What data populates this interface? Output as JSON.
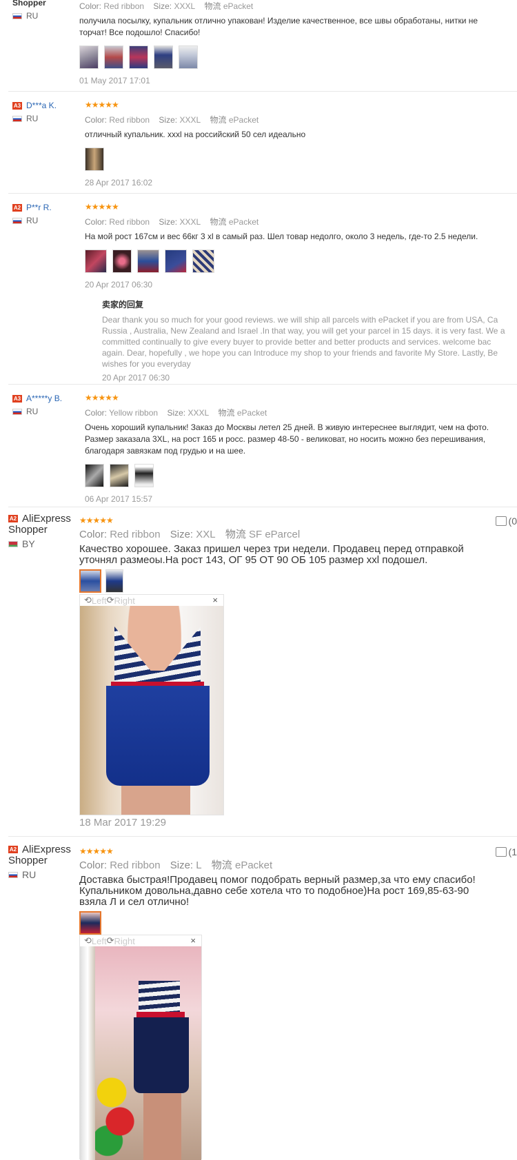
{
  "colors": {
    "accent": "#f79411",
    "link": "#2a66b4",
    "badge": "#e0401f"
  },
  "reviews": [
    {
      "name": "Shopper",
      "badge": "",
      "country": "RU",
      "stars": "★★★★★",
      "color_label": "Color:",
      "color_value": "Red ribbon",
      "size_label": "Size:",
      "size_value": "XXXL",
      "shipping_label": "物流",
      "shipping_value": "ePacket",
      "text": "получила посылку, купальник отлично упакован! Изделие качественное, все швы обработаны, нитки не торчат! Все подошло! Спасибо!",
      "date": "01 May 2017 17:01"
    },
    {
      "name": "D***a K.",
      "badge": "A3",
      "country": "RU",
      "stars": "★★★★★",
      "color_label": "Color:",
      "color_value": "Red ribbon",
      "size_label": "Size:",
      "size_value": "XXXL",
      "shipping_label": "物流",
      "shipping_value": "ePacket",
      "text": "отличный купальник. xxxl на российский 50 сел идеально",
      "date": "28 Apr 2017 16:02"
    },
    {
      "name": "P**r R.",
      "badge": "A2",
      "country": "RU",
      "stars": "★★★★★",
      "color_label": "Color:",
      "color_value": "Red ribbon",
      "size_label": "Size:",
      "size_value": "XXXL",
      "shipping_label": "物流",
      "shipping_value": "ePacket",
      "text": "На мой рост 167см и вес 66кг 3 xl в самый раз. Шел товар недолго, около 3 недель, где-то 2.5 недели.",
      "date": "20 Apr 2017 06:30",
      "reply_title": "卖家的回复",
      "reply_lines": [
        "Dear thank you so much for your good reviews. we will ship all parcels with ePacket if you are from USA, Ca",
        "Russia , Australia, New Zealand and Israel .In that way, you will get your parcel in 15 days. it is very fast. We a",
        "committed continually to give every buyer to provide better and better products and services. welcome bac",
        "again. Dear, hopefully , we hope you can Introduce my shop to your friends and favorite My Store. Lastly, Be",
        "wishes for you everyday"
      ],
      "reply_date": "20 Apr 2017 06:30"
    },
    {
      "name": "A*****y B.",
      "badge": "A3",
      "country": "RU",
      "stars": "★★★★★",
      "color_label": "Color:",
      "color_value": "Yellow ribbon",
      "size_label": "Size:",
      "size_value": "XXXL",
      "shipping_label": "物流",
      "shipping_value": "ePacket",
      "text_lines": [
        "Очень хороший купальник! Заказ до Москвы летел 25 дней. В живую интереснее выглядит, чем на фото.",
        "Размер заказала 3XL, на рост 165 и росс. размер 48-50 - великоват, но носить можно без перешивания,",
        "благодаря завязкам под грудью и на шее."
      ],
      "date": "06 Apr 2017 15:57"
    },
    {
      "name": "AliExpress",
      "name2": "Shopper",
      "badge": "A2",
      "country": "BY",
      "stars": "★★★★★",
      "color_label": "Color:",
      "color_value": "Red ribbon",
      "size_label": "Size:",
      "size_value": "XXL",
      "shipping_label": "物流",
      "shipping_value": "SF eParcel",
      "text_lines": [
        "Качество хорошее. Заказ пришел через три недели. Продавец перед отправкой",
        "уточнял размеоы.На рост 143, ОГ 95 ОТ 90 ОБ 105 размер xxl подошел."
      ],
      "viewer_left": "Left",
      "viewer_right": "Right",
      "viewer_close": "×",
      "helpful": "(0",
      "date": "18 Mar 2017 19:29"
    },
    {
      "name": "AliExpress",
      "name2": "Shopper",
      "badge": "A2",
      "country": "RU",
      "stars": "★★★★★",
      "color_label": "Color:",
      "color_value": "Red ribbon",
      "size_label": "Size:",
      "size_value": "L",
      "shipping_label": "物流",
      "shipping_value": "ePacket",
      "text_lines": [
        "Доставка быстрая!Продавец помог подобрать верный размер,за что ему спасибо!",
        "Купальником довольна,давно себе хотела что то подобное)На рост 169,85-63-90",
        "взяла Л и сел отлично!"
      ],
      "viewer_left": "Left",
      "viewer_right": "Right",
      "viewer_close": "×",
      "helpful": "(1"
    }
  ]
}
